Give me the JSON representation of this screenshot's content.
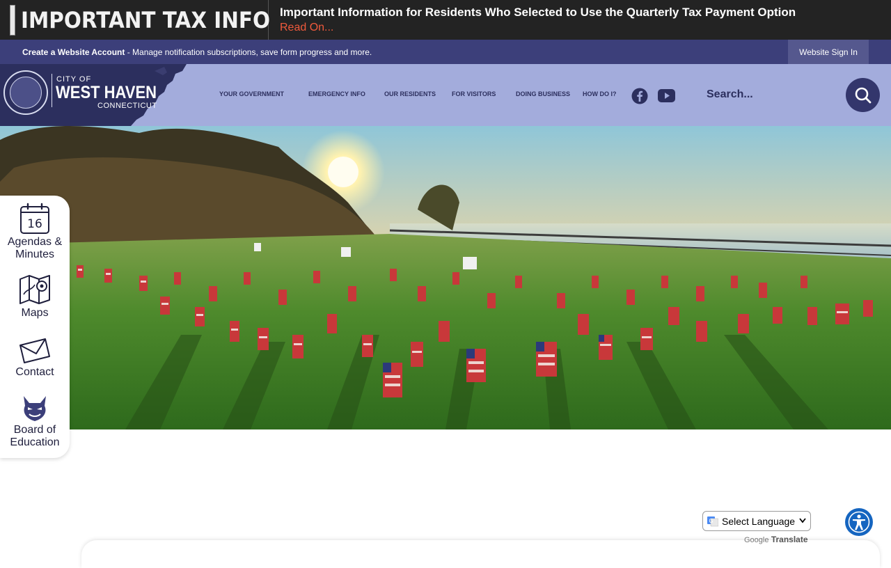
{
  "alert": {
    "title": "IMPORTANT TAX INFO",
    "headline": "Important Information for Residents Who Selected to Use the Quarterly Tax Payment Option",
    "link": "Read On..."
  },
  "account": {
    "create_label": "Create a Website Account",
    "description": " - Manage notification subscriptions, save form progress and more.",
    "signin_label": "Website Sign In"
  },
  "logo": {
    "city_of": "CITY OF",
    "name": "WEST HAVEN",
    "state": "CONNECTICUT"
  },
  "nav": {
    "items": [
      {
        "label": "YOUR GOVERNMENT"
      },
      {
        "label": "EMERGENCY INFO"
      },
      {
        "label": "OUR RESIDENTS"
      },
      {
        "label": "FOR VISITORS"
      },
      {
        "label": "DOING BUSINESS"
      },
      {
        "label": "HOW DO I?"
      }
    ]
  },
  "social": {
    "facebook_icon": "facebook-icon",
    "youtube_icon": "youtube-icon"
  },
  "search": {
    "placeholder": "Search...",
    "icon": "search-icon"
  },
  "quick_links": {
    "items": [
      {
        "label_line1": "Agendas &",
        "label_line2": "Minutes",
        "icon": "calendar-icon",
        "icon_text": "16"
      },
      {
        "label_line1": "Maps",
        "label_line2": "",
        "icon": "map-icon"
      },
      {
        "label_line1": "Contact",
        "label_line2": "",
        "icon": "envelope-icon"
      },
      {
        "label_line1": "Board of",
        "label_line2": "Education",
        "icon": "devil-mascot-icon"
      }
    ]
  },
  "translate": {
    "select_label": "Select Language",
    "powered_by": "Google",
    "translate_word": "Translate"
  },
  "colors": {
    "alert_bg": "#232323",
    "link_orange": "#f05a3c",
    "account_bar": "#3c3f7a",
    "header_bg": "#a3acdc",
    "navy": "#2c2f5e",
    "accessibility_blue": "#1565c0"
  }
}
